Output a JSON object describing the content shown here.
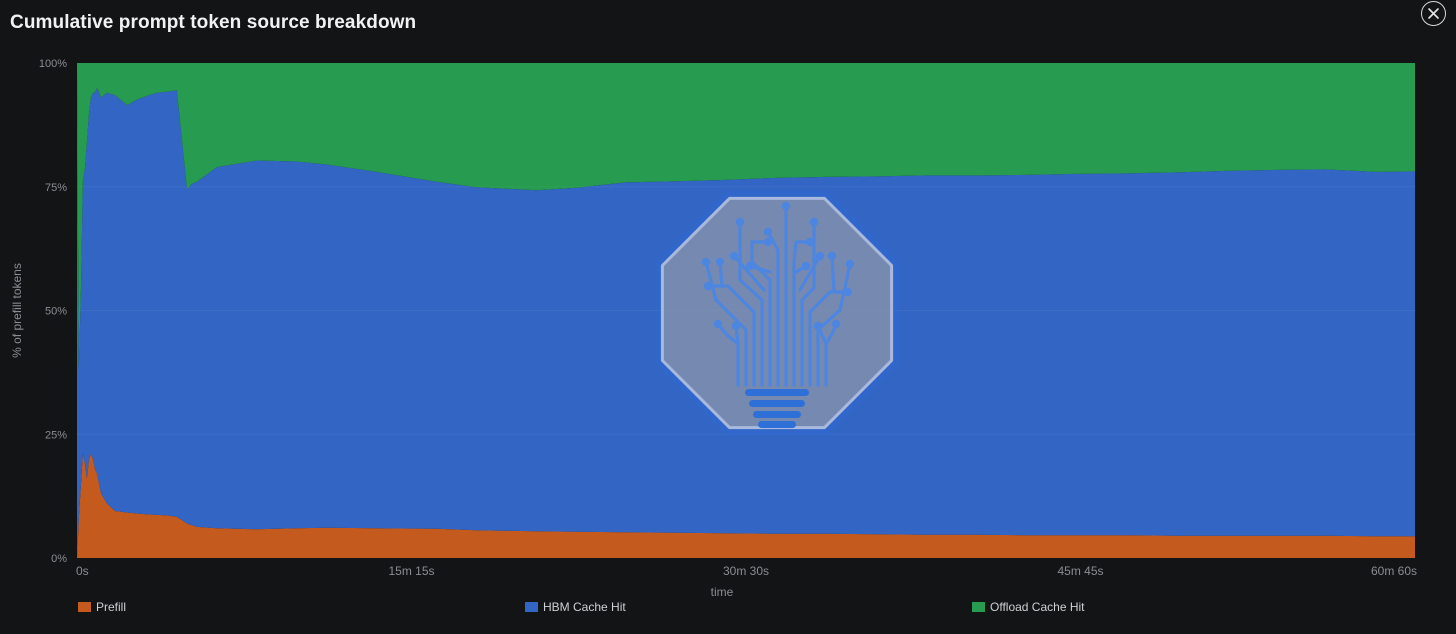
{
  "dialog": {
    "title": "Cumulative prompt token source breakdown",
    "close_icon": "close-icon"
  },
  "colors": {
    "prefill": "#c55a1f",
    "hbm": "#3366c4",
    "offload": "#279b4f",
    "axis_text": "#8c8c93",
    "background": "#131416"
  },
  "watermark_icon": "lightbulb-circuit-tree-icon",
  "chart_data": {
    "type": "area",
    "stacked": true,
    "normalized": true,
    "title": "",
    "xlabel": "time",
    "ylabel": "% of prefill tokens",
    "x_unit": "seconds",
    "xlim": [
      0,
      3660
    ],
    "ylim": [
      0,
      100
    ],
    "x_tick_values": [
      0,
      915,
      1830,
      2745,
      3660
    ],
    "x_tick_labels": [
      "0s",
      "15m 15s",
      "30m 30s",
      "45m 45s",
      "60m 60s"
    ],
    "y_tick_values": [
      0,
      25,
      50,
      75,
      100
    ],
    "y_tick_labels": [
      "0%",
      "25%",
      "50%",
      "75%",
      "100%"
    ],
    "grid": true,
    "legend_position": "bottom",
    "x": [
      0,
      5,
      11,
      16,
      22,
      27,
      33,
      38,
      44,
      49,
      55,
      66,
      82,
      104,
      137,
      164,
      197,
      219,
      246,
      273,
      301,
      306,
      312,
      328,
      383,
      492,
      546,
      601,
      683,
      820,
      984,
      1093,
      1257,
      1366,
      1503,
      1640,
      1776,
      1913,
      2049,
      2186,
      2322,
      2459,
      2596,
      2732,
      2869,
      3006,
      3142,
      3279,
      3415,
      3552,
      3660
    ],
    "series": [
      {
        "name": "Prefill",
        "values": [
          0,
          8,
          15,
          21,
          19,
          16,
          20,
          21,
          20,
          18,
          17,
          13,
          11,
          9.5,
          9.2,
          9.0,
          8.8,
          8.7,
          8.6,
          8.3,
          7.0,
          6.8,
          6.7,
          6.3,
          6.0,
          5.8,
          5.9,
          6.0,
          6.1,
          6.0,
          5.9,
          5.6,
          5.4,
          5.3,
          5.2,
          5.1,
          5.0,
          4.9,
          4.9,
          4.8,
          4.7,
          4.7,
          4.6,
          4.6,
          4.6,
          4.5,
          4.5,
          4.5,
          4.5,
          4.4,
          4.4
        ]
      },
      {
        "name": "HBM Cache Hit",
        "values": [
          100,
          30,
          40,
          55,
          60,
          68,
          70,
          72,
          74,
          76,
          78,
          80,
          83,
          84,
          82.3,
          83.6,
          84.7,
          85.3,
          85.6,
          86.2,
          67.5,
          68.0,
          68.8,
          69.7,
          73.0,
          74.5,
          74.3,
          74.1,
          73.4,
          72.0,
          70.1,
          69.3,
          68.9,
          69.5,
          70.7,
          71.0,
          71.4,
          71.9,
          72.1,
          72.3,
          72.6,
          72.6,
          72.8,
          73.0,
          73.1,
          73.4,
          73.7,
          73.9,
          74.0,
          73.6,
          73.7
        ]
      },
      {
        "name": "Offload Cache Hit",
        "values": [
          0,
          62,
          45,
          24,
          21,
          16,
          10,
          7,
          6,
          6,
          5,
          7,
          6,
          6.5,
          8.5,
          7.4,
          6.5,
          6.0,
          5.8,
          5.5,
          25.5,
          25.2,
          24.5,
          24.0,
          21.0,
          19.7,
          19.8,
          19.9,
          20.5,
          22.0,
          24.0,
          25.1,
          25.7,
          25.2,
          24.1,
          23.9,
          23.6,
          23.2,
          23.0,
          22.9,
          22.7,
          22.7,
          22.6,
          22.4,
          22.3,
          22.1,
          21.8,
          21.6,
          21.5,
          22.0,
          21.9
        ]
      }
    ]
  }
}
